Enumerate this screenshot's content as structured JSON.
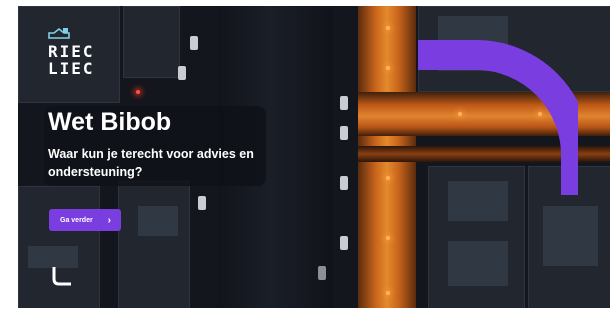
{
  "brand": {
    "logo_text_line1": "RIEC",
    "logo_text_line2": "LIEC",
    "logo_icon": "riec-liec-emblem-icon",
    "corner_icon": "l-shape-corner-icon"
  },
  "hero": {
    "title": "Wet Bibob",
    "subtitle": "Waar kun je terecht voor advies en ondersteuning?"
  },
  "cta": {
    "label": "Ga verder",
    "icon": "chevron-right-icon"
  },
  "colors": {
    "accent_purple": "#7a3ee0",
    "card_bg": "#0f1118",
    "street_orange": "#e08430"
  }
}
